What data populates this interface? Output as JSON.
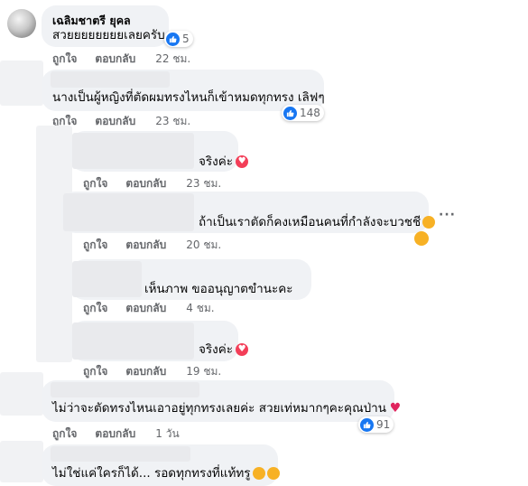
{
  "comments": [
    {
      "id": "c1",
      "name": "เฉลิมชาตรี ยุคล",
      "text": "สวยยยยยยยยเลยครับ",
      "reactions": "5",
      "like": "ถูกใจ",
      "reply": "ตอบกลับ",
      "time": "22 ชม."
    },
    {
      "id": "c2",
      "text": "นางเป็นผู้หญิงที่ตัดผมทรงไหนก็เข้าหมดทุกทรง เลิฟๆ",
      "reactions": "148",
      "like": "ถูกใจ",
      "reply": "ตอบกลับ",
      "time": "23 ชม."
    },
    {
      "id": "r1",
      "text": "จริงค่ะ",
      "like": "ถูกใจ",
      "reply": "ตอบกลับ",
      "time": "23 ชม."
    },
    {
      "id": "r2",
      "text": "ถ้าเป็นเราตัดก็คงเหมือนคนที่กำลังจะบวชชี",
      "like": "ถูกใจ",
      "reply": "ตอบกลับ",
      "time": "20 ชม."
    },
    {
      "id": "r3",
      "text": "เห็นภาพ ขออนุญาตขำนะคะ",
      "like": "ถูกใจ",
      "reply": "ตอบกลับ",
      "time": "4 ชม."
    },
    {
      "id": "r4",
      "text": "จริงค่ะ",
      "like": "ถูกใจ",
      "reply": "ตอบกลับ",
      "time": "19 ชม."
    },
    {
      "id": "c3",
      "text": "ไม่ว่าจะตัดทรงไหนเอาอยู่ทุกทรงเลยค่ะ สวยเท่หมากๆคะคุณป่าน",
      "reactions": "91",
      "like": "ถูกใจ",
      "reply": "ตอบกลับ",
      "time": "1 วัน"
    },
    {
      "id": "c4",
      "text": "ไม่ใช่แค่ใครก็ได้... รอดทุกทรงที่แท้ทรู"
    }
  ],
  "icons": {
    "like": "like-icon",
    "heart": "heart-icon",
    "laugh": "laugh-emoji-icon",
    "heart_eyes": "heart-eyes-emoji-icon",
    "more": "more-options-icon"
  },
  "colors": {
    "bubble": "#f0f2f5",
    "like_blue": "#1877f2",
    "heart_red": "#f33e58",
    "meta_gray": "#65676b"
  }
}
